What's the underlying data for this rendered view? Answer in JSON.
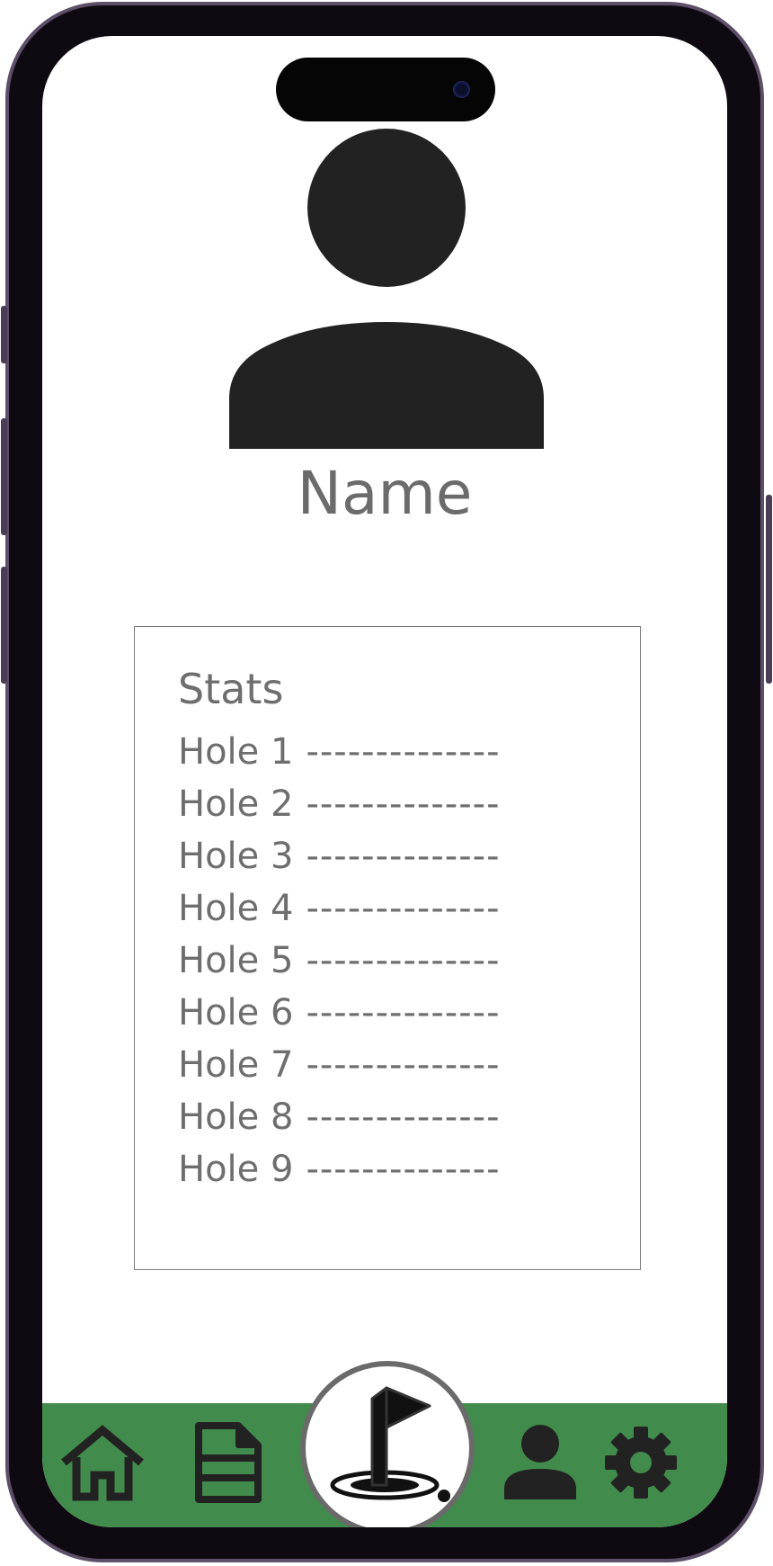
{
  "profile": {
    "name": "Name"
  },
  "stats": {
    "title": "Stats",
    "holes": [
      {
        "label": "Hole 1",
        "value": "--------------"
      },
      {
        "label": "Hole 2",
        "value": "--------------"
      },
      {
        "label": "Hole 3",
        "value": "--------------"
      },
      {
        "label": "Hole 4",
        "value": "--------------"
      },
      {
        "label": "Hole 5",
        "value": "--------------"
      },
      {
        "label": "Hole 6",
        "value": "--------------"
      },
      {
        "label": "Hole 7",
        "value": "--------------"
      },
      {
        "label": "Hole 8",
        "value": "--------------"
      },
      {
        "label": "Hole 9",
        "value": "--------------"
      }
    ]
  },
  "nav": {
    "items": [
      {
        "icon": "home-icon"
      },
      {
        "icon": "document-icon"
      },
      {
        "icon": "golf-flag-icon"
      },
      {
        "icon": "user-icon"
      },
      {
        "icon": "gear-icon"
      }
    ]
  },
  "colors": {
    "nav_background": "#418c4c",
    "text": "#6e6e6e",
    "icon": "#222222"
  }
}
